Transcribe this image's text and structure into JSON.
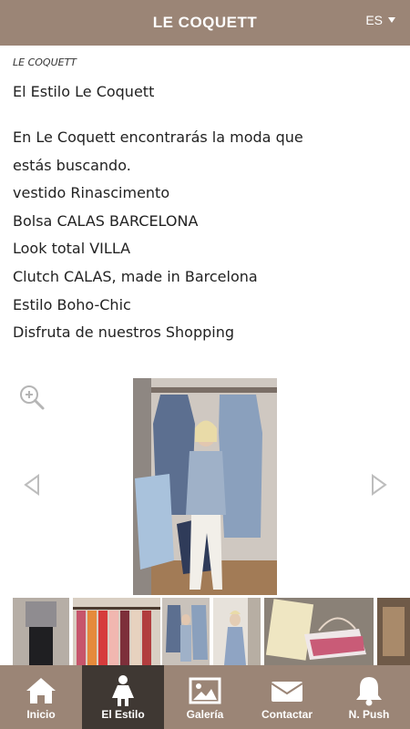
{
  "header": {
    "title": "LE COQUETT",
    "language": "ES"
  },
  "breadcrumb": "LE COQUETT",
  "page": {
    "heading": "El Estilo Le Coquett",
    "lines": [
      "En Le Coquett encontrarás la moda que estás buscando.",
      "vestido Rinascimento",
      "Bolsa CALAS BARCELONA",
      "Look total VILLA",
      "Clutch CALAS, made in Barcelona",
      "Estilo Boho-Chic",
      "Disfruta de nuestros Shopping"
    ]
  },
  "tabs": [
    {
      "label": "Inicio",
      "icon": "home-icon"
    },
    {
      "label": "El Estilo",
      "icon": "person-icon"
    },
    {
      "label": "Galería",
      "icon": "picture-icon"
    },
    {
      "label": "Contactar",
      "icon": "envelope-icon"
    },
    {
      "label": "N. Push",
      "icon": "bell-icon"
    }
  ],
  "colors": {
    "bar": "#9b8576",
    "active_tab": "#3f3833"
  }
}
